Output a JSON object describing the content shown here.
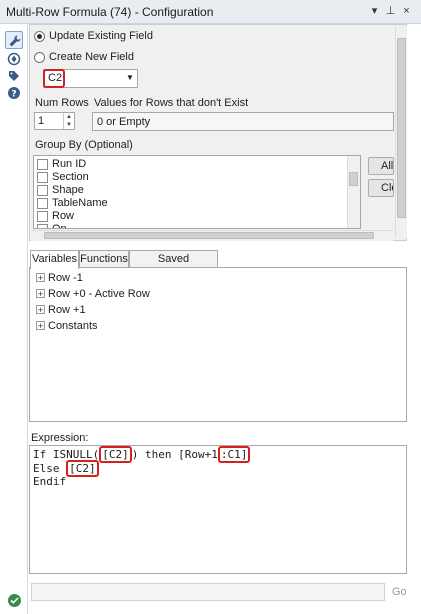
{
  "window": {
    "title": "Multi-Row Formula (74) - Configuration",
    "controls": [
      "▾",
      "⊥",
      "×"
    ]
  },
  "toolbar_icons": [
    "wrench-icon",
    "globe-icon",
    "tag-icon",
    "help-icon"
  ],
  "config": {
    "update_existing_label": "Update Existing Field",
    "create_new_label": "Create New  Field",
    "field_value": "C2",
    "num_rows_label": "Num Rows",
    "num_rows_value": "1",
    "values_label": "Values for Rows that don't Exist",
    "values_selected": "0 or Empty",
    "group_by_label": "Group By (Optional)",
    "group_fields": [
      "Run ID",
      "Section",
      "Shape",
      "TableName",
      "Row",
      "Op"
    ],
    "all_button": "All",
    "clear_button": "Clear"
  },
  "tabs": [
    "Variables",
    "Functions",
    "Saved Expressions"
  ],
  "variables": [
    "Row -1",
    "Row +0 - Active Row",
    "Row +1",
    "Constants"
  ],
  "expression": {
    "label": "Expression:",
    "line1_a": "If ISNULL(",
    "line1_b": "[C2]",
    "line1_c": ") then [Row+1",
    "line1_d": ":C1]",
    "line2_a": "Else ",
    "line2_b": "[C2]",
    "line3": "Endif"
  },
  "go_label": "Go",
  "colors": {
    "highlight_red": "#d62020",
    "titlebar": "#e9ecf1",
    "status_green": "#3a8a4a"
  }
}
